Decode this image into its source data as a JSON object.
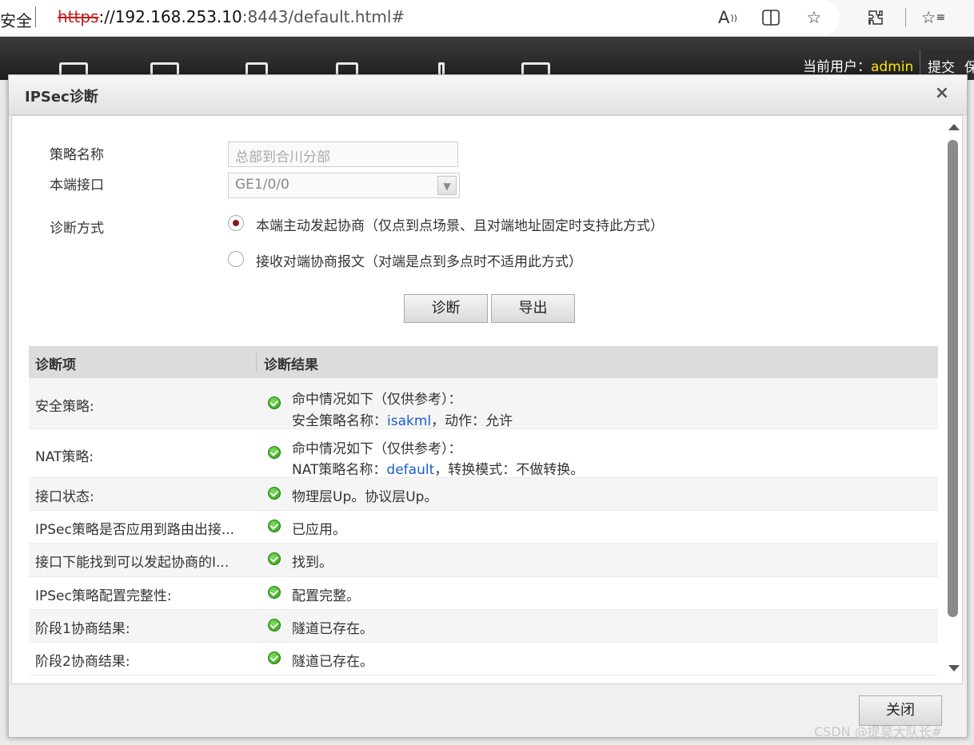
{
  "browser": {
    "security_label": "安全",
    "url_scheme": "https",
    "url_host": "://192.168.253.10",
    "url_rest": ":8443/default.html#"
  },
  "app": {
    "current_user_label": "当前用户：",
    "current_user": "admin",
    "submit_label": "提交",
    "submit_extra": "保"
  },
  "dialog": {
    "title": "IPSec诊断",
    "close_glyph": "×",
    "form": {
      "policy_name_label": "策略名称",
      "policy_name_value": "总部到合川分部",
      "local_interface_label": "本端接口",
      "local_interface_value": "GE1/0/0",
      "diag_method_label": "诊断方式",
      "options": [
        {
          "label": "本端主动发起协商（仅点到点场景、且对端地址固定时支持此方式）",
          "checked": true
        },
        {
          "label": "接收对端协商报文（对端是点到多点时不适用此方式）",
          "checked": false
        }
      ],
      "diagnose_button": "诊断",
      "export_button": "导出"
    },
    "table": {
      "headers": [
        "诊断项",
        "诊断结果"
      ],
      "rows": [
        {
          "item": "安全策略:",
          "line1": "命中情况如下（仅供参考）：",
          "line2_pre": "安全策略名称：",
          "line2_link": "isakml",
          "line2_post": "，动作：允许"
        },
        {
          "item": "NAT策略:",
          "line1": "命中情况如下（仅供参考）：",
          "line2_pre": "NAT策略名称：",
          "line2_link": "default",
          "line2_post": "，转换模式：不做转换。"
        },
        {
          "item": "接口状态:",
          "line1": "物理层Up。协议层Up。"
        },
        {
          "item": "IPSec策略是否应用到路由出接...",
          "line1": "已应用。"
        },
        {
          "item": "接口下能找到可以发起协商的I...",
          "line1": "找到。"
        },
        {
          "item": "IPSec策略配置完整性:",
          "line1": "配置完整。"
        },
        {
          "item": "阶段1协商结果:",
          "line1": "隧道已存在。"
        },
        {
          "item": "阶段2协商结果:",
          "line1": "隧道已存在。"
        }
      ]
    },
    "footer": {
      "close_button": "关闭"
    }
  },
  "watermark": "CSDN @提莫大队长#"
}
